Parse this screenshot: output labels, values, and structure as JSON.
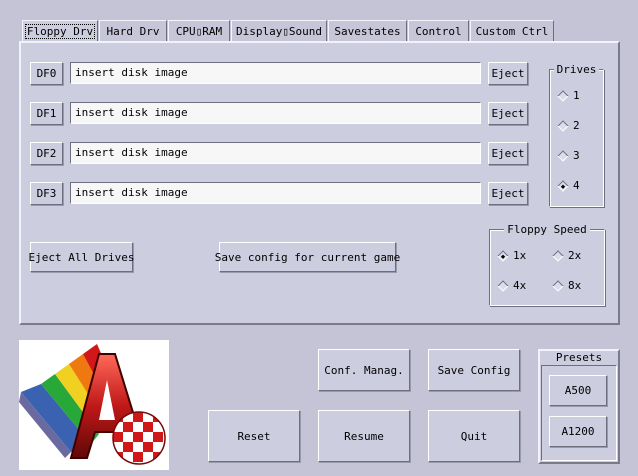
{
  "tabs": [
    "Floppy Drv",
    "Hard Drv",
    "CPU▯RAM",
    "Display▯Sound",
    "Savestates",
    "Control",
    "Custom Ctrl"
  ],
  "drives": [
    {
      "label": "DF0",
      "path": "insert disk image",
      "eject": "Eject"
    },
    {
      "label": "DF1",
      "path": "insert disk image",
      "eject": "Eject"
    },
    {
      "label": "DF2",
      "path": "insert disk image",
      "eject": "Eject"
    },
    {
      "label": "DF3",
      "path": "insert disk image",
      "eject": "Eject"
    }
  ],
  "drive_count": {
    "title": "Drives",
    "options": [
      "1",
      "2",
      "3",
      "4"
    ],
    "selected": "4"
  },
  "floppy_speed": {
    "title": "Floppy Speed",
    "options": [
      "1x",
      "2x",
      "4x",
      "8x"
    ],
    "selected": "1x"
  },
  "eject_all_label": "Eject All Drives",
  "save_game_config_label": "Save config for current game",
  "buttons": {
    "conf_manag": "Conf. Manag.",
    "save_config": "Save Config",
    "reset": "Reset",
    "resume": "Resume",
    "quit": "Quit"
  },
  "presets": {
    "title": "Presets",
    "a500": "A500",
    "a1200": "A1200"
  },
  "logo_icon": "amiga-boing-logo-icon",
  "colors": {
    "background": "#c4c4d6",
    "panel": "#cdcde0",
    "field": "#f7f7f7"
  }
}
